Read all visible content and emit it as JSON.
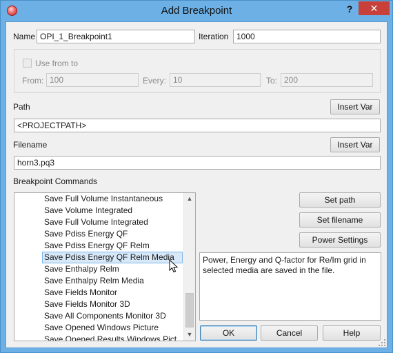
{
  "window": {
    "title": "Add Breakpoint",
    "help_label": "?",
    "close_label": "✕",
    "app_icon": "red-circle-icon"
  },
  "form": {
    "name_label": "Name",
    "name_value": "OPI_1_Breakpoint1",
    "iteration_label": "Iteration",
    "iteration_value": "1000",
    "use_from_to_label": "Use from to",
    "use_from_to_checked": false,
    "from_label": "From:",
    "from_value": "100",
    "every_label": "Every:",
    "every_value": "10",
    "to_label": "To:",
    "to_value": "200",
    "path_label": "Path",
    "path_value": "<PROJECTPATH>",
    "filename_label": "Filename",
    "filename_value": "horn3.pq3",
    "insert_var_label": "Insert Var"
  },
  "commands": {
    "label": "Breakpoint Commands",
    "items": [
      "Save Full Volume Instantaneous",
      "Save Volume Integrated",
      "Save Full Volume Integrated",
      "Save Pdiss Energy QF",
      "Save Pdiss Energy QF Relm",
      "Save Pdiss Energy QF Relm Media",
      "Save Enthalpy Relm",
      "Save Enthalpy Relm Media",
      "Save Fields Monitor",
      "Save Fields Monitor 3D",
      "Save All Components Monitor 3D",
      "Save Opened Windows Picture",
      "Save Opened Results Windows Pict"
    ],
    "selected_index": 5,
    "set_path_label": "Set path",
    "set_filename_label": "Set filename",
    "power_settings_label": "Power Settings",
    "description": "Power, Energy and Q-factor for Re/Im grid in selected media are saved in the file."
  },
  "footer": {
    "ok_label": "OK",
    "cancel_label": "Cancel",
    "help_label": "Help"
  },
  "colors": {
    "titlebar": "#6cb0e6",
    "close": "#c7403a",
    "selection": "#d7e8f8"
  }
}
